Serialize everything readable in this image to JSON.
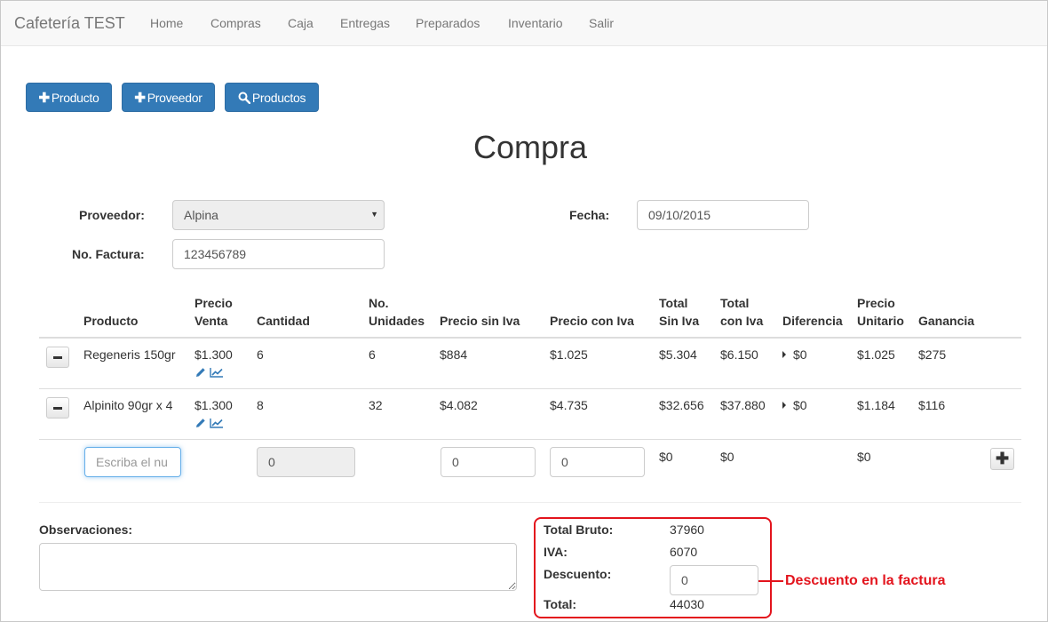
{
  "navbar": {
    "brand": "Cafetería TEST",
    "items": [
      "Home",
      "Compras",
      "Caja",
      "Entregas",
      "Preparados",
      "Inventario",
      "Salir"
    ]
  },
  "actions": {
    "producto": "Producto",
    "proveedor": "Proveedor",
    "productos": "Productos"
  },
  "page_title": "Compra",
  "form": {
    "proveedor_label": "Proveedor:",
    "proveedor_value": "Alpina",
    "fecha_label": "Fecha:",
    "fecha_value": "09/10/2015",
    "factura_label": "No. Factura:",
    "factura_value": "123456789"
  },
  "table": {
    "headers": {
      "producto": "Producto",
      "precio_venta_1": "Precio",
      "precio_venta_2": "Venta",
      "cantidad": "Cantidad",
      "unidades_1": "No.",
      "unidades_2": "Unidades",
      "sin_iva": "Precio sin Iva",
      "con_iva": "Precio con Iva",
      "total_sin_1": "Total",
      "total_sin_2": "Sin Iva",
      "total_con_1": "Total",
      "total_con_2": "con Iva",
      "diferencia": "Diferencia",
      "unitario_1": "Precio",
      "unitario_2": "Unitario",
      "ganancia": "Ganancia"
    },
    "rows": [
      {
        "producto": "Regeneris 150gr",
        "precio_venta": "$1.300",
        "cantidad": "6",
        "unidades": "6",
        "sin_iva": "$884",
        "con_iva": "$1.025",
        "total_sin": "$5.304",
        "total_con": "$6.150",
        "diferencia": "$0",
        "unitario": "$1.025",
        "ganancia": "$275"
      },
      {
        "producto": "Alpinito 90gr x 4",
        "precio_venta": "$1.300",
        "cantidad": "8",
        "unidades": "32",
        "sin_iva": "$4.082",
        "con_iva": "$4.735",
        "total_sin": "$32.656",
        "total_con": "$37.880",
        "diferencia": "$0",
        "unitario": "$1.184",
        "ganancia": "$116"
      }
    ],
    "new_row": {
      "producto_placeholder": "Escriba el nu",
      "cantidad": "0",
      "sin_iva": "0",
      "con_iva": "0",
      "total_sin": "$0",
      "total_con": "$0",
      "unitario": "$0"
    }
  },
  "observaciones_label": "Observaciones:",
  "totals": {
    "bruto_label": "Total Bruto:",
    "bruto_value": "37960",
    "iva_label": "IVA:",
    "iva_value": "6070",
    "descuento_label": "Descuento:",
    "descuento_value": "0",
    "total_label": "Total:",
    "total_value": "44030"
  },
  "annotation": "Descuento en la factura",
  "colors": {
    "primary": "#337ab7",
    "annotation": "#e3141d",
    "icon": "#337ab7"
  }
}
